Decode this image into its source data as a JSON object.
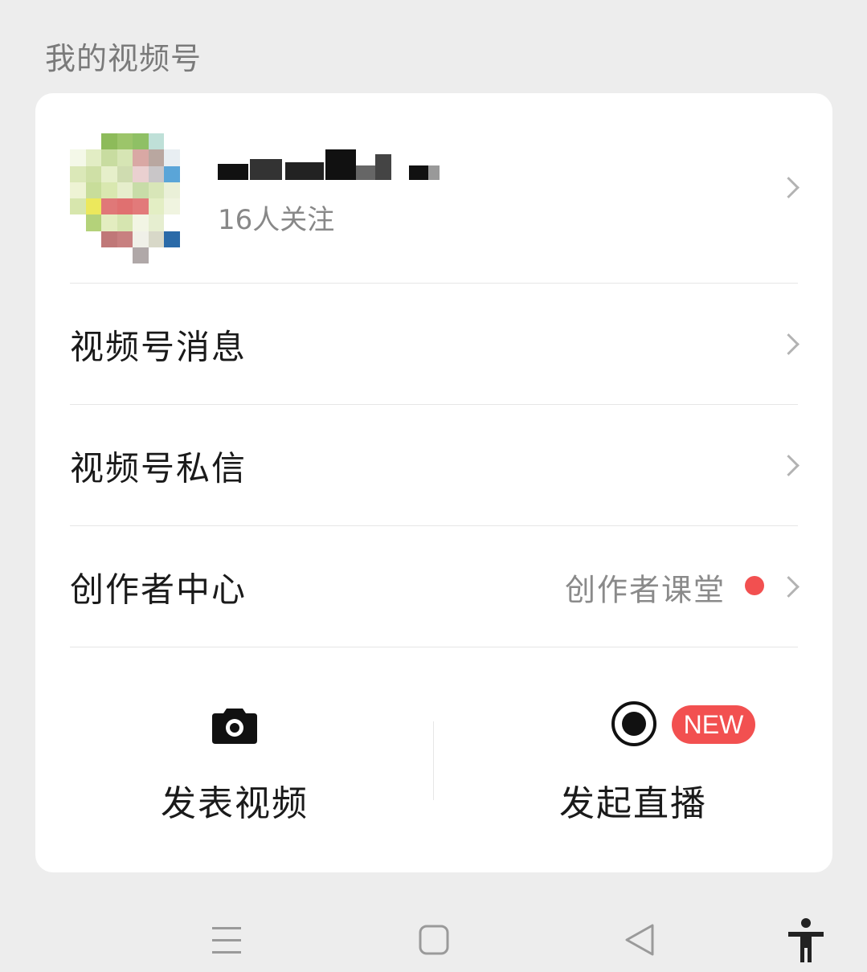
{
  "section": {
    "title": "我的视频号"
  },
  "profile": {
    "follow_text": "16人关注",
    "name_redacted": true
  },
  "menu": {
    "items": [
      {
        "label": "视频号消息"
      },
      {
        "label": "视频号私信"
      },
      {
        "label": "创作者中心",
        "extra": "创作者课堂",
        "badge_dot": true
      }
    ]
  },
  "actions": {
    "post_video": {
      "label": "发表视频",
      "icon": "camera-icon"
    },
    "go_live": {
      "label": "发起直播",
      "icon": "live-record-icon",
      "badge": "NEW"
    }
  },
  "navbar": {
    "icons": [
      "menu-icon",
      "home-square-icon",
      "back-triangle-icon",
      "accessibility-icon"
    ]
  },
  "colors": {
    "background": "#ededed",
    "card": "#ffffff",
    "accent_red": "#f25050",
    "primary_text": "#1a1a1a",
    "secondary_text": "#888888"
  }
}
